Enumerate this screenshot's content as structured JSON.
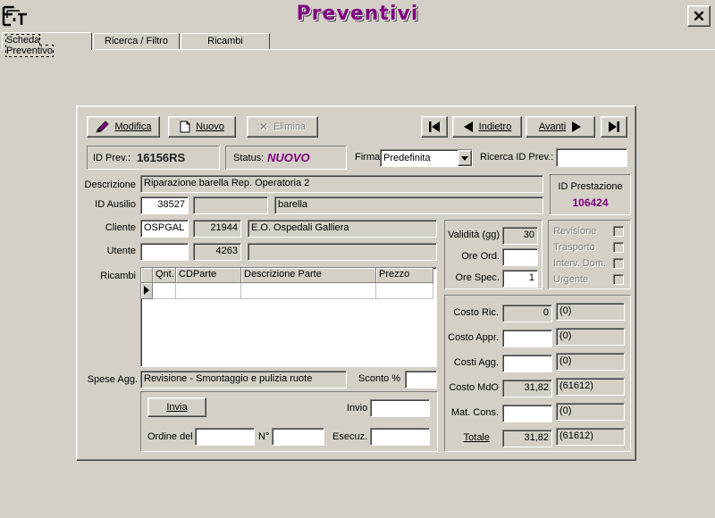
{
  "window": {
    "title": "Preventivi",
    "close_symbol": "✕",
    "app_icon": "app-logo-icon"
  },
  "tabs": [
    {
      "label": "Scheda Preventivo",
      "active": true
    },
    {
      "label": "Ricerca / Filtro",
      "active": false
    },
    {
      "label": "Ricambi",
      "active": false
    }
  ],
  "toolbar": {
    "modifica": "Modifica",
    "nuovo": "Nuovo",
    "elimina": "Elimina",
    "indietro": "Indietro",
    "avanti": "Avanti"
  },
  "header": {
    "id_prev_label": "ID Prev.:",
    "id_prev_value": "16156RS",
    "status_label": "Status:",
    "status_value": "NUOVO",
    "firma_label": "Firma",
    "firma_value": "Predefinita",
    "ricerca_label": "Ricerca ID Prev.:",
    "ricerca_value": ""
  },
  "form": {
    "descrizione_label": "Descrizione",
    "descrizione_value": "Riparazione barella Rep. Operatoria 2",
    "id_prestazione_label": "ID Prestazione",
    "id_prestazione_value": "106424",
    "id_ausilio_label": "ID Ausilio",
    "id_ausilio_value": "38527",
    "ausilio_extra": "",
    "ausilio_desc": "barella",
    "cliente_label": "Cliente",
    "cliente_code": "OSPGAL",
    "cliente_num": "21944",
    "cliente_name": "E.O. Ospedali Galliera",
    "utente_label": "Utente",
    "utente_code": "",
    "utente_num": "4263",
    "utente_name": "",
    "ricambi_label": "Ricambi",
    "spese_label": "Spese Agg.",
    "spese_value": "Revisione - Smontaggio e pulizia ruote",
    "sconto_label": "Sconto %",
    "sconto_value": ""
  },
  "ricambi_grid": {
    "columns": [
      "Qnt.",
      "CDParte",
      "Descrizione Parte",
      "Prezzo"
    ],
    "rows": [
      {
        "qnt": "",
        "cdparte": "",
        "descrizione": "",
        "prezzo": ""
      }
    ]
  },
  "validita": {
    "validita_label": "Validità (gg)",
    "validita_value": "30",
    "ore_ord_label": "Ore Ord.",
    "ore_ord_value": "",
    "ore_spec_label": "Ore Spec.",
    "ore_spec_value": "1"
  },
  "flags": {
    "revisione": "Revisione",
    "trasporto": "Trasporto",
    "interv_dom": "Interv. Dom.",
    "urgente": "Urgente"
  },
  "invio": {
    "invia_button": "Invia",
    "invio_label": "Invio",
    "invio_value": "",
    "ordine_label": "Ordine del",
    "ordine_value": "",
    "n_label": "N°",
    "n_value": "",
    "esecuz_label": "Esecuz.",
    "esecuz_value": ""
  },
  "costi": {
    "ric_label": "Costo Ric.",
    "ric_value": "0",
    "ric_note": "(0)",
    "appr_label": "Costo Appr.",
    "appr_value": "",
    "appr_note": "(0)",
    "agg_label": "Costi Agg.",
    "agg_value": "",
    "agg_note": "(0)",
    "mdo_label": "Costo MdO",
    "mdo_value": "31,82",
    "mdo_note": "(61612)",
    "mat_label": "Mat. Cons.",
    "mat_value": "",
    "mat_note": "(0)",
    "totale_label": "Totale",
    "totale_value": "31,82",
    "totale_note": "(61612)"
  },
  "colors": {
    "accent": "#800080",
    "face": "#d4d0c8"
  }
}
